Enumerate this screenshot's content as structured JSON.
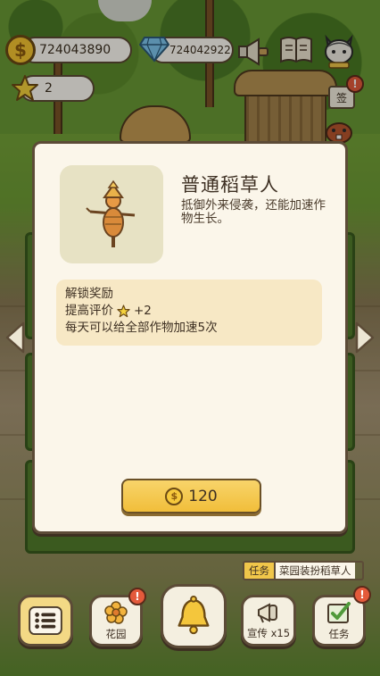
{
  "hud": {
    "coins": "724043890",
    "gems": "724042922",
    "stars": "2",
    "sign_label": "签"
  },
  "dialog": {
    "title": "普通稻草人",
    "description": "抵御外来侵袭，还能加速作物生长。",
    "reward_heading": "解锁奖励",
    "reward_rating_label": "提高评价",
    "reward_rating_value": "+2",
    "reward_effect": "每天可以给全部作物加速5次",
    "price": "120"
  },
  "task": {
    "tag": "任务",
    "text": "菜园装扮稻草人"
  },
  "nav": {
    "garden": "花园",
    "promote": "宣传 x15",
    "tasks": "任务"
  },
  "alerts": {
    "mark": "!"
  },
  "colors": {
    "panel": "#fbf6ea",
    "border": "#5c4b37",
    "button": "#f1be3a",
    "alert": "#e45a3b"
  }
}
